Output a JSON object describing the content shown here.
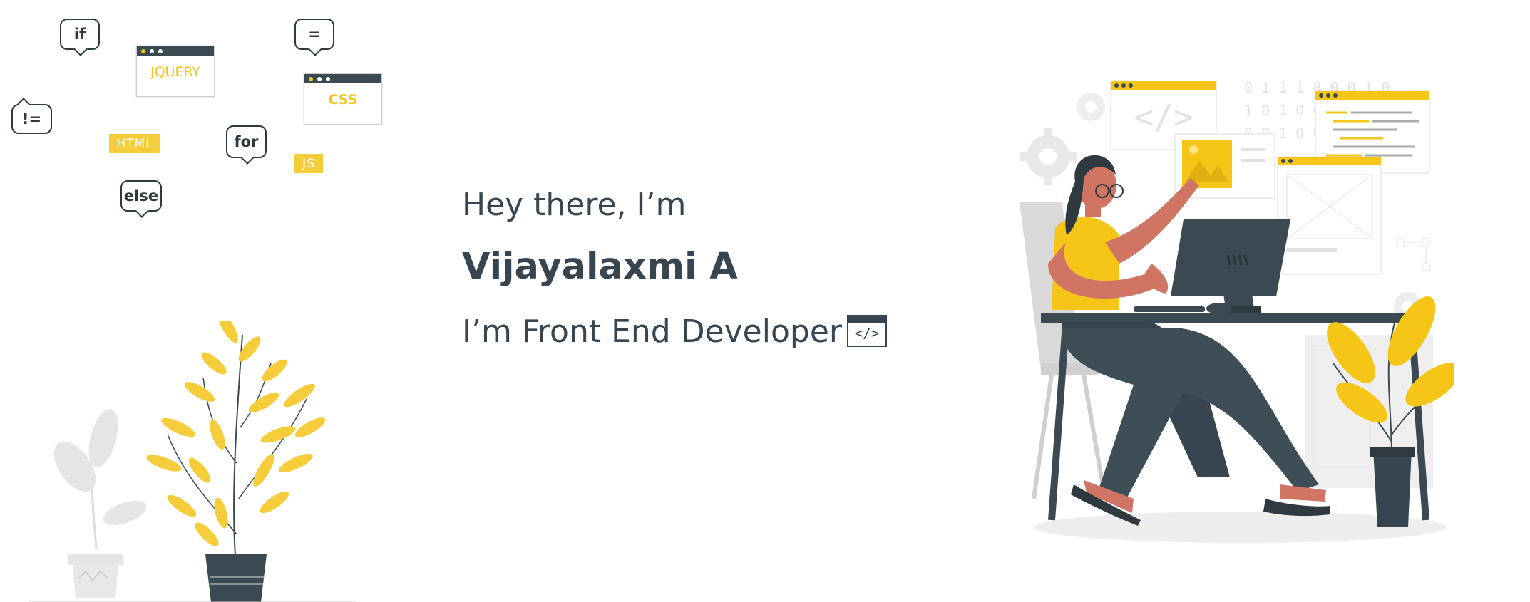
{
  "floating_code": {
    "bubbles": [
      "if",
      "=",
      "!=",
      "for",
      "else"
    ],
    "windows": [
      "JQUERY",
      "CSS"
    ],
    "tags": [
      "HTML",
      "JS"
    ]
  },
  "hero": {
    "greeting": "Hey there, I’m",
    "name": "Vijayalaxmi A",
    "role": "I’m Front End Developer",
    "code_icon": "</>"
  },
  "illustration": {
    "binary_rows": [
      "0 1 1 1 0 0 0 1 0",
      "1 0 1 0 0 0 1",
      "0 0 1 0 0 1 1"
    ],
    "code_glyph": "</>",
    "icons": [
      "gear-icon",
      "image-icon",
      "monitor-icon",
      "plant-icon"
    ]
  },
  "colors": {
    "accent": "#f5c518",
    "dark": "#36454f",
    "skin": "#d07563",
    "light_gray": "#e6e6e6"
  }
}
